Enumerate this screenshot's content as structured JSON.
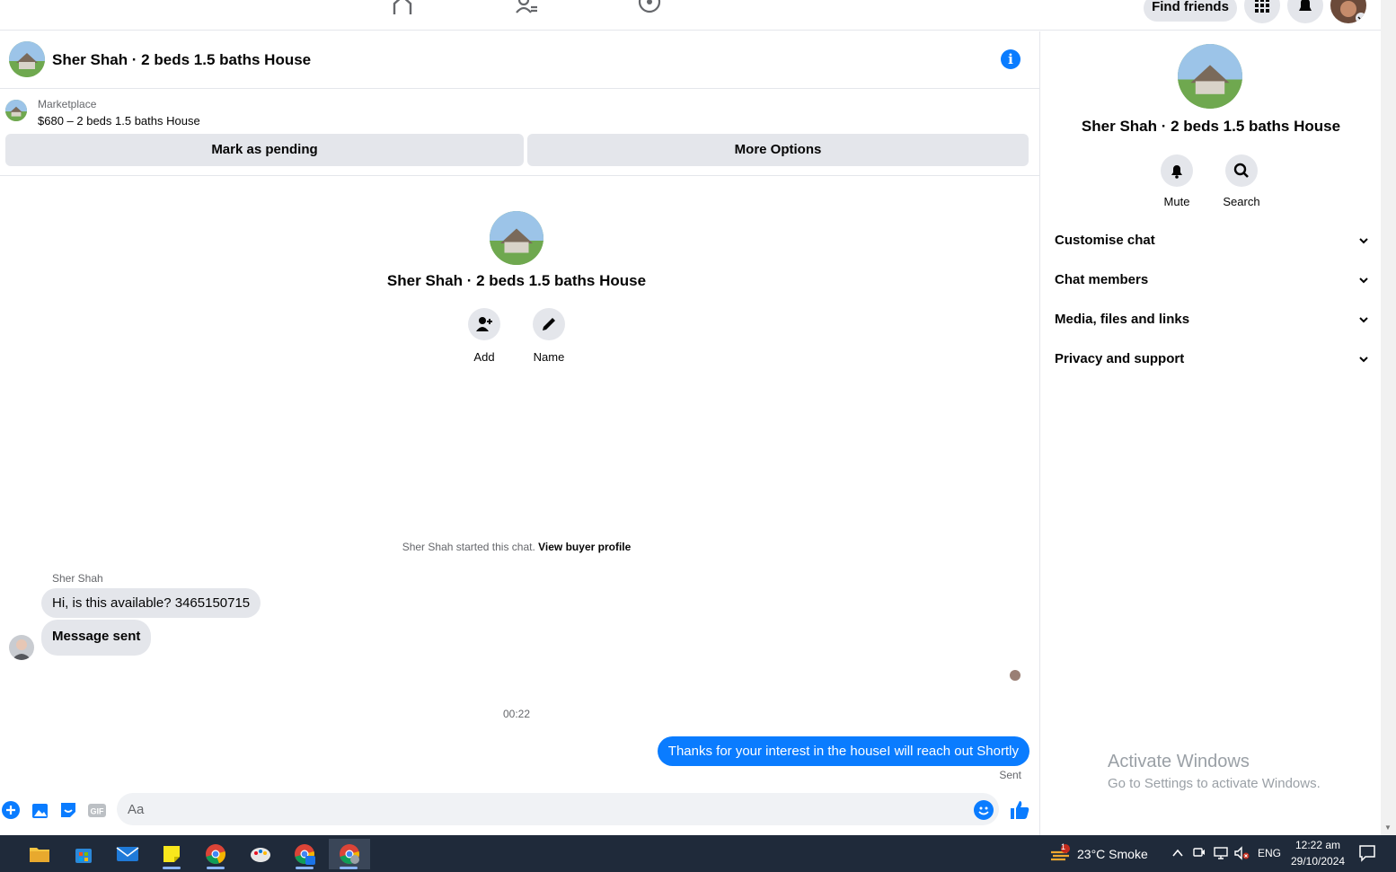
{
  "topnav": {
    "find_friends_label": "Find friends"
  },
  "chat": {
    "title": "Sher Shah · 2 beds 1.5 baths House",
    "marketplace": {
      "label": "Marketplace",
      "listing": "$680 – 2 beds 1.5 baths House",
      "mark_pending_label": "Mark as pending",
      "more_options_label": "More Options"
    },
    "intro": {
      "title": "Sher Shah · 2 beds 1.5 baths House",
      "add_label": "Add",
      "name_label": "Name"
    },
    "started_text": "Sher Shah started this chat.",
    "view_buyer_profile": "View buyer profile",
    "messages": [
      {
        "sender": "Sher Shah",
        "text": "Hi, is this available? 3465150715"
      },
      {
        "text": "Message sent"
      }
    ],
    "timestamp": "00:22",
    "outgoing": "Thanks for your interest in the houseI will reach out Shortly",
    "status": "Sent",
    "composer_placeholder": "Aa"
  },
  "panel": {
    "title": "Sher Shah · 2 beds 1.5 baths House",
    "mute_label": "Mute",
    "search_label": "Search",
    "sections": [
      "Customise chat",
      "Chat members",
      "Media, files and links",
      "Privacy and support"
    ]
  },
  "watermark": {
    "line1": "Activate Windows",
    "line2": "Go to Settings to activate Windows."
  },
  "taskbar": {
    "weather": "23°C  Smoke",
    "weather_badge": "1",
    "lang": "ENG",
    "time": "12:22 am",
    "date": "29/10/2024"
  },
  "colors": {
    "accent": "#0a7cff",
    "bubble_in": "#e4e6eb",
    "taskbar": "#1f2a3a"
  }
}
